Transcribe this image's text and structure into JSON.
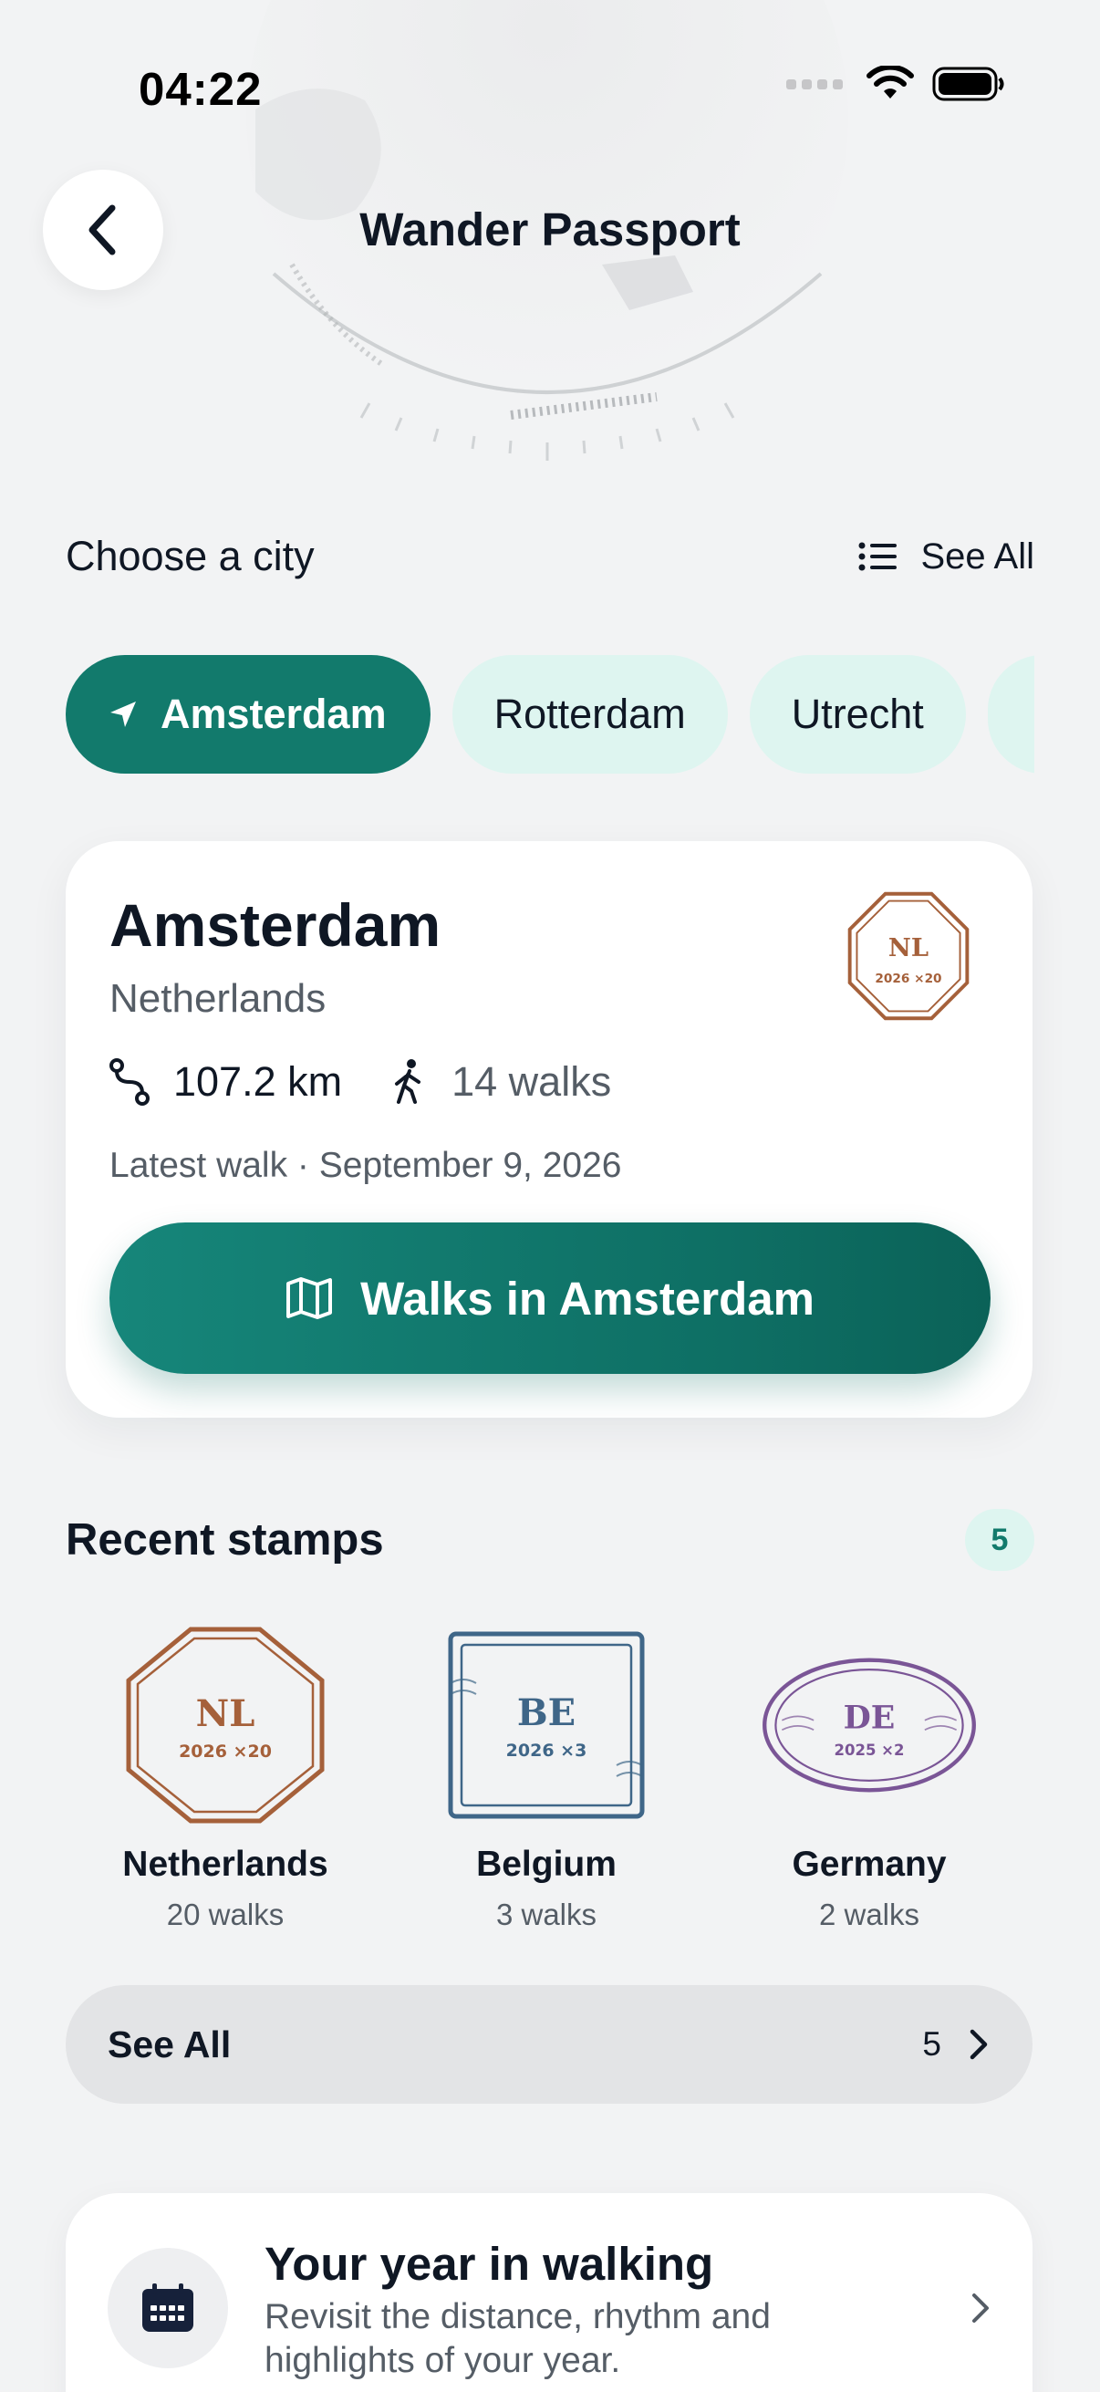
{
  "status_bar": {
    "time": "04:22"
  },
  "nav": {
    "title": "Wander Passport",
    "back_icon": "chevron-left-icon"
  },
  "city_section": {
    "label": "Choose a city",
    "see_all": "See All"
  },
  "chips": [
    {
      "label": "Amsterdam",
      "active": true,
      "icon": "location-arrow-icon"
    },
    {
      "label": "Rotterdam",
      "active": false
    },
    {
      "label": "Utrecht",
      "active": false
    }
  ],
  "city_card": {
    "name": "Amsterdam",
    "country": "Netherlands",
    "distance": "107.2 km",
    "walks": "14 walks",
    "latest_walk": "Latest walk · September 9, 2026",
    "button_label": "Walks in Amsterdam",
    "stamp": {
      "code": "NL",
      "sub": "2026 ×20"
    }
  },
  "recent_stamps": {
    "title": "Recent stamps",
    "count": "5",
    "items": [
      {
        "code": "NL",
        "sub": "2026 ×20",
        "name": "Netherlands",
        "walks": "20 walks",
        "color": "#a5603a"
      },
      {
        "code": "BE",
        "sub": "2026 ×3",
        "name": "Belgium",
        "walks": "3 walks",
        "color": "#3f6688"
      },
      {
        "code": "DE",
        "sub": "2025 ×2",
        "name": "Germany",
        "walks": "2 walks",
        "color": "#7a5596"
      }
    ],
    "see_all_label": "See All",
    "see_all_count": "5"
  },
  "year_card": {
    "title": "Your year in walking",
    "subtitle": "Revisit the distance, rhythm and highlights of your year."
  },
  "colors": {
    "accent": "#127a6c",
    "chip_bg": "#def5f0",
    "background": "#f2f3f4"
  }
}
